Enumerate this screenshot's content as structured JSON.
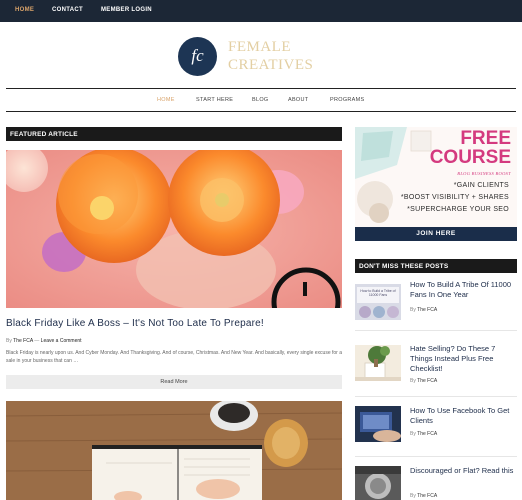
{
  "topnav": [
    {
      "label": "HOME",
      "active": true
    },
    {
      "label": "CONTACT",
      "active": false
    },
    {
      "label": "MEMBER LOGIN",
      "active": false
    }
  ],
  "logo": {
    "initials": "fc",
    "line1": "FEMALE",
    "line2": "CREATIVES"
  },
  "mainnav": [
    {
      "label": "HOME",
      "active": true
    },
    {
      "label": "START HERE",
      "active": false
    },
    {
      "label": "BLOG",
      "active": false
    },
    {
      "label": "ABOUT",
      "active": false
    },
    {
      "label": "PROGRAMS",
      "active": false
    }
  ],
  "featured": {
    "heading": "FEATURED ARTICLE",
    "title": "Black Friday Like A Boss – It's Not Too Late To Prepare!",
    "by": "By",
    "author": "The FCA",
    "separator": "—",
    "comment": "Leave a Comment",
    "excerpt": "Black Friday is nearly upon us. And Cyber Monday. And Thanksgiving. And of course, Christmas. And New Year. And basically, every single excuse for a sale in your business that can …",
    "read_more": "Read More"
  },
  "ad": {
    "line1": "FREE",
    "line2": "COURSE",
    "subtitle": "BLOG BUSINESS BOOST",
    "bullets": [
      "*GAIN CLIENTS",
      "*BOOST VISIBILITY + SHARES",
      "*SUPERCHARGE YOUR SEO"
    ],
    "cta": "JOIN HERE"
  },
  "sidebar": {
    "heading": "DON'T MISS THESE POSTS",
    "posts": [
      {
        "title": "How To Build A Tribe Of 11000 Fans In One Year",
        "by": "By",
        "author": "The FCA",
        "thumb_text": "How to Build a Tribe of 11000 Fans"
      },
      {
        "title": "Hate Selling? Do These 7 Things Instead Plus Free Checklist!",
        "by": "By",
        "author": "The FCA"
      },
      {
        "title": "How To Use Facebook To Get Clients",
        "by": "By",
        "author": "The FCA"
      },
      {
        "title": "Discouraged or Flat? Read this",
        "by": "By",
        "author": "The FCA"
      }
    ]
  },
  "colors": {
    "topbar": "#1c2736",
    "accent": "#d9a36a",
    "ad_pink": "#d43a7f",
    "navy": "#1a2d4a"
  }
}
